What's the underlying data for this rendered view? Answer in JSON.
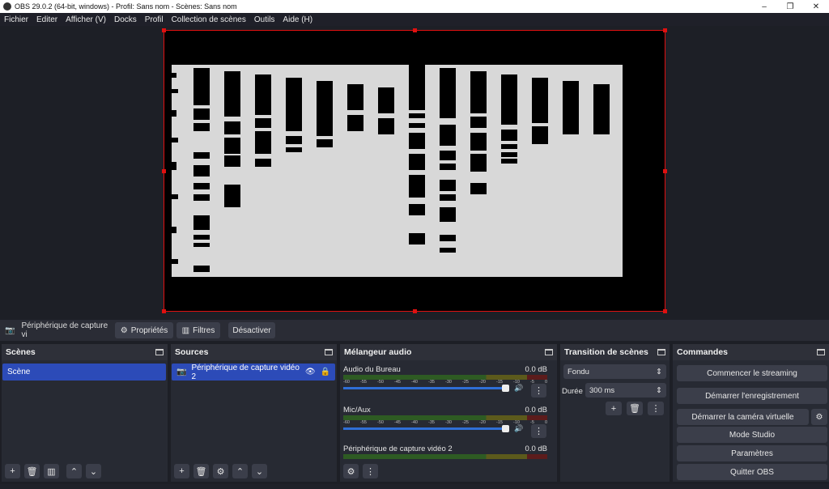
{
  "window": {
    "title": "OBS 29.0.2 (64-bit, windows) - Profil: Sans nom - Scènes: Sans nom",
    "minimize": "–",
    "restore": "❐",
    "close": "✕"
  },
  "menu": [
    "Fichier",
    "Editer",
    "Afficher (V)",
    "Docks",
    "Profil",
    "Collection de scènes",
    "Outils",
    "Aide (H)"
  ],
  "source_toolbar": {
    "source_name": "Périphérique de capture vi",
    "properties": "Propriétés",
    "filters": "Filtres",
    "deactivate": "Désactiver"
  },
  "docks": {
    "scenes": {
      "title": "Scènes",
      "items": [
        "Scène"
      ]
    },
    "sources": {
      "title": "Sources",
      "items": [
        "Périphérique de capture vidéo 2"
      ]
    },
    "mixer": {
      "title": "Mélangeur audio",
      "scale": [
        "-60",
        "-55",
        "-50",
        "-45",
        "-40",
        "-35",
        "-30",
        "-25",
        "-20",
        "-15",
        "-10",
        "-5",
        "0"
      ],
      "channels": [
        {
          "name": "Audio du Bureau",
          "db": "0.0 dB"
        },
        {
          "name": "Mic/Aux",
          "db": "0.0 dB"
        },
        {
          "name": "Périphérique de capture vidéo 2",
          "db": "0.0 dB"
        }
      ]
    },
    "transitions": {
      "title": "Transition de scènes",
      "transition": "Fondu",
      "duration_label": "Durée",
      "duration": "300 ms"
    },
    "controls": {
      "title": "Commandes",
      "buttons": [
        "Commencer le streaming",
        "Démarrer l'enregistrement",
        "Démarrer la caméra virtuelle",
        "Mode Studio",
        "Paramètres",
        "Quitter OBS"
      ]
    }
  }
}
